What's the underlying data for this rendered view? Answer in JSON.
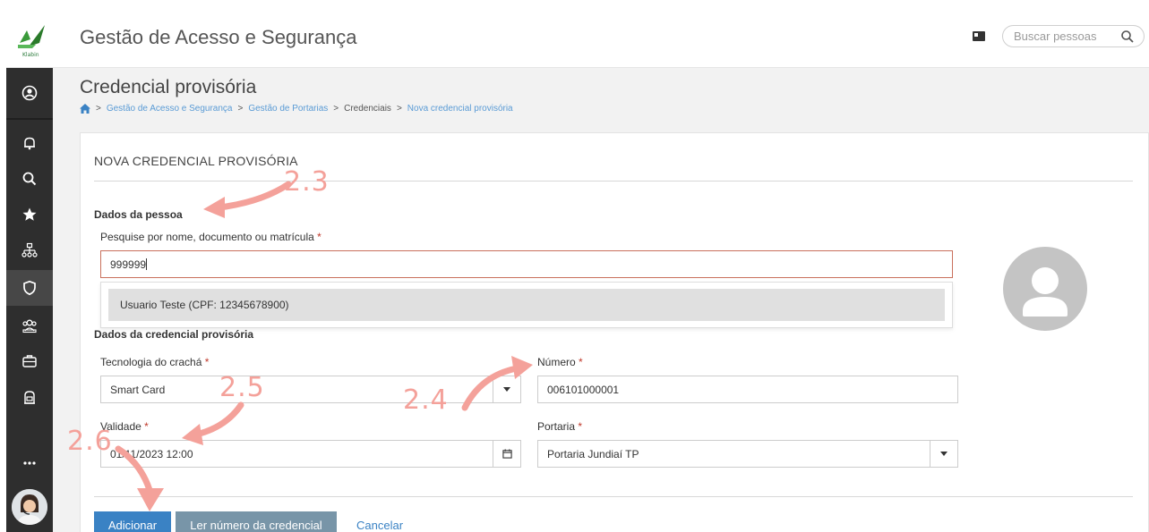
{
  "header": {
    "logo_text": "Klabin",
    "app_title": "Gestão de Acesso e Segurança",
    "search_placeholder": "Buscar pessoas"
  },
  "sidebar": {
    "items": [
      {
        "name": "profile",
        "icon": "user-circle-icon"
      },
      {
        "name": "notifications",
        "icon": "bell-icon"
      },
      {
        "name": "search",
        "icon": "search-icon"
      },
      {
        "name": "favorites",
        "icon": "star-icon"
      },
      {
        "name": "org-chart",
        "icon": "sitemap-icon"
      },
      {
        "name": "security",
        "icon": "shield-icon",
        "active": true
      },
      {
        "name": "visitors",
        "icon": "group-icon"
      },
      {
        "name": "briefcase",
        "icon": "briefcase-icon"
      },
      {
        "name": "backpack",
        "icon": "backpack-icon"
      },
      {
        "name": "more",
        "icon": "more-icon"
      }
    ]
  },
  "page": {
    "title": "Credencial provisória",
    "breadcrumb": [
      "Gestão de Acesso e Segurança",
      "Gestão de Portarias",
      "Credenciais",
      "Nova credencial provisória"
    ]
  },
  "form": {
    "card_title": "NOVA CREDENCIAL PROVISÓRIA",
    "section_person": "Dados da pessoa",
    "search_label": "Pesquise por nome, documento ou matrícula",
    "search_value": "999999",
    "suggestion": "Usuario Teste (CPF: 12345678900)",
    "section_credential": "Dados da credencial provisória",
    "tech_label": "Tecnologia do crachá",
    "tech_value": "Smart Card",
    "numero_label": "Número",
    "numero_value": "006101000001",
    "validade_label": "Validade",
    "validade_value": "01/11/2023 12:00",
    "portaria_label": "Portaria",
    "portaria_value": "Portaria Jundiaí TP",
    "required_mark": "*"
  },
  "actions": {
    "add_label": "Adicionar",
    "read_label": "Ler número da credencial",
    "cancel_label": "Cancelar"
  },
  "annotations": {
    "a23": "2.3",
    "a24": "2.4",
    "a25": "2.5",
    "a26": "2.6"
  },
  "colors": {
    "primary": "#3a82c4",
    "sidebar": "#2e2e2e",
    "annotation": "#f4a19a",
    "required": "#c0392b"
  }
}
